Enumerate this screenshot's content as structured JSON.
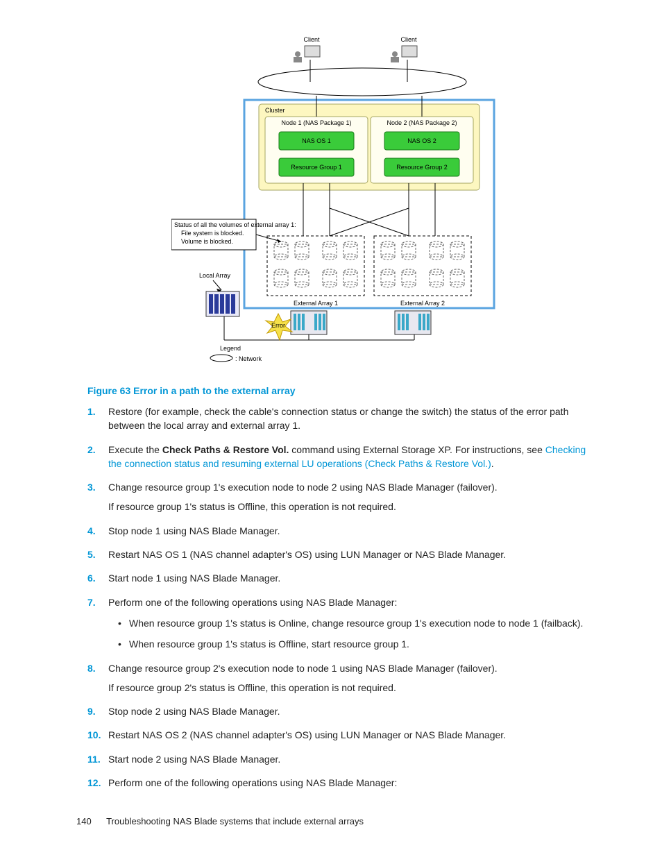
{
  "diagram": {
    "client": "Client",
    "cluster": "Cluster",
    "node1": "Node 1 (NAS Package 1)",
    "node2": "Node 2 (NAS Package 2)",
    "nasos1": "NAS OS 1",
    "nasos2": "NAS OS 2",
    "rg1": "Resource Group 1",
    "rg2": "Resource Group 2",
    "status_title": "Status of all the volumes of external array 1:",
    "status_line1": "File system is blocked.",
    "status_line2": "Volume is blocked.",
    "local_array": "Local Array",
    "ext1": "External Array 1",
    "ext2": "External Array 2",
    "error": "Error",
    "legend": "Legend",
    "legend_net": ": Network"
  },
  "figure_title": "Figure 63 Error in a path to the external array",
  "steps": [
    {
      "n": "1",
      "text": "Restore (for example, check the cable's connection status or change the switch) the status of the error path between the local array and external array 1."
    },
    {
      "n": "2",
      "prefix": "Execute the ",
      "bold": "Check Paths & Restore Vol.",
      "mid": " command using External Storage XP. For instructions, see ",
      "link": "Checking the connection status and resuming external LU operations (Check Paths & Restore Vol.)",
      "suffix": "."
    },
    {
      "n": "3",
      "text": "Change resource group 1's execution node to node 2 using NAS Blade Manager (failover).",
      "note": "If resource group 1's status is Offline, this operation is not required."
    },
    {
      "n": "4",
      "text": "Stop node 1 using NAS Blade Manager."
    },
    {
      "n": "5",
      "text": "Restart NAS OS 1 (NAS channel adapter's OS) using LUN Manager or NAS Blade Manager."
    },
    {
      "n": "6",
      "text": "Start node 1 using NAS Blade Manager."
    },
    {
      "n": "7",
      "text": "Perform one of the following operations using NAS Blade Manager:",
      "sub": [
        "When resource group 1's status is Online, change resource group 1's execution node to node 1 (failback).",
        "When resource group 1's status is Offline, start resource group 1."
      ]
    },
    {
      "n": "8",
      "text": "Change resource group 2's execution node to node 1 using NAS Blade Manager (failover).",
      "note": "If resource group 2's status is Offline, this operation is not required."
    },
    {
      "n": "9",
      "text": "Stop node 2 using NAS Blade Manager."
    },
    {
      "n": "10",
      "text": "Restart NAS OS 2 (NAS channel adapter's OS) using LUN Manager or NAS Blade Manager."
    },
    {
      "n": "11",
      "text": "Start node 2 using NAS Blade Manager."
    },
    {
      "n": "12",
      "text": "Perform one of the following operations using NAS Blade Manager:"
    }
  ],
  "footer_page": "140",
  "footer_text": "Troubleshooting NAS Blade systems that include external arrays"
}
